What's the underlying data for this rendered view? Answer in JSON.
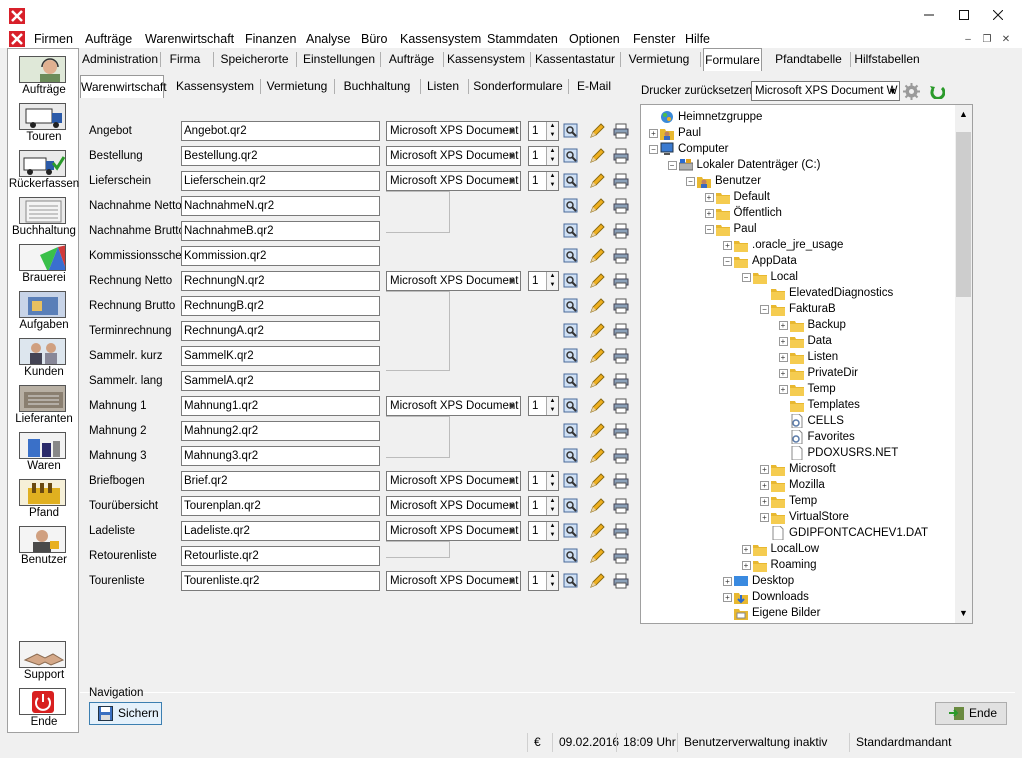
{
  "menu": {
    "items": [
      "Firmen",
      "Aufträge",
      "Warenwirtschaft",
      "Finanzen",
      "Analyse",
      "Büro",
      "Kassensystem",
      "Stammdaten",
      "Optionen",
      "Fenster",
      "Hilfe"
    ]
  },
  "sidebar": {
    "items": [
      {
        "label": "Aufträge",
        "icon": "headset-person-icon"
      },
      {
        "label": "Touren",
        "icon": "truck-icon"
      },
      {
        "label": "Rückerfassen",
        "icon": "truck-check-icon"
      },
      {
        "label": "Buchhaltung",
        "icon": "ledger-icon"
      },
      {
        "label": "Brauerei",
        "icon": "brewery-icon"
      },
      {
        "label": "Aufgaben",
        "icon": "tasks-icon"
      },
      {
        "label": "Kunden",
        "icon": "customers-icon"
      },
      {
        "label": "Lieferanten",
        "icon": "supplier-icon"
      },
      {
        "label": "Waren",
        "icon": "goods-icon"
      },
      {
        "label": "Pfand",
        "icon": "bottle-crate-icon"
      },
      {
        "label": "Benutzer",
        "icon": "user-icon"
      },
      {
        "label": "Support",
        "icon": "handshake-icon"
      },
      {
        "label": "Ende",
        "icon": "power-icon"
      }
    ]
  },
  "tabs_top": [
    "Administration",
    "Firma",
    "Speicherorte",
    "Einstellungen",
    "Aufträge",
    "Kassensystem",
    "Kassentastatur",
    "Vermietung",
    "Formulare",
    "Pfandtabelle",
    "Hilfstabellen"
  ],
  "tabs_sub": [
    "Warenwirtschaft",
    "Kassensystem",
    "Vermietung",
    "Buchhaltung",
    "Listen",
    "Sonderformulare",
    "E-Mail"
  ],
  "printer_reset": {
    "label": "Drucker zurücksetzen:",
    "value": "Microsoft XPS Document W"
  },
  "forms": [
    {
      "label": "Angebot",
      "file": "Angebot.qr2",
      "printer": "Microsoft XPS Document Writer",
      "copies": "1"
    },
    {
      "label": "Bestellung",
      "file": "Bestellung.qr2",
      "printer": "Microsoft XPS Document Writer",
      "copies": "1"
    },
    {
      "label": "Lieferschein",
      "file": "Lieferschein.qr2",
      "printer": "Microsoft XPS Document Writer",
      "copies": "1"
    },
    {
      "label": "Nachnahme Netto",
      "file": "NachnahmeN.qr2",
      "printer": "",
      "copies": ""
    },
    {
      "label": "Nachnahme Brutto",
      "file": "NachnahmeB.qr2",
      "printer": "",
      "copies": ""
    },
    {
      "label": "Kommissionsschein",
      "file": "Kommission.qr2",
      "printer": "",
      "copies": ""
    },
    {
      "label": "Rechnung Netto",
      "file": "RechnungN.qr2",
      "printer": "Microsoft XPS Document Writer",
      "copies": "1"
    },
    {
      "label": "Rechnung Brutto",
      "file": "RechnungB.qr2",
      "printer": "",
      "copies": ""
    },
    {
      "label": "Terminrechnung",
      "file": "RechnungA.qr2",
      "printer": "",
      "copies": ""
    },
    {
      "label": "Sammelr. kurz",
      "file": "SammelK.qr2",
      "printer": "",
      "copies": ""
    },
    {
      "label": "Sammelr. lang",
      "file": "SammelA.qr2",
      "printer": "",
      "copies": ""
    },
    {
      "label": "Mahnung 1",
      "file": "Mahnung1.qr2",
      "printer": "Microsoft XPS Document Writer",
      "copies": "1"
    },
    {
      "label": "Mahnung 2",
      "file": "Mahnung2.qr2",
      "printer": "",
      "copies": ""
    },
    {
      "label": "Mahnung 3",
      "file": "Mahnung3.qr2",
      "printer": "",
      "copies": ""
    },
    {
      "label": "Briefbogen",
      "file": "Brief.qr2",
      "printer": "Microsoft XPS Document Writer",
      "copies": "1"
    },
    {
      "label": "Tourübersicht",
      "file": "Tourenplan.qr2",
      "printer": "Microsoft XPS Document Writer",
      "copies": "1"
    },
    {
      "label": "Ladeliste",
      "file": "Ladeliste.qr2",
      "printer": "Microsoft XPS Document Writer",
      "copies": "1"
    },
    {
      "label": "Retourenliste",
      "file": "Retourliste.qr2",
      "printer": "",
      "copies": ""
    },
    {
      "label": "Tourenliste",
      "file": "Tourenliste.qr2",
      "printer": "Microsoft XPS Document Writer",
      "copies": "1"
    }
  ],
  "tree": [
    {
      "label": "Heimnetzgruppe",
      "depth": 0,
      "exp": "",
      "icon": "homegroup-icon"
    },
    {
      "label": "Paul",
      "depth": 0,
      "exp": "+",
      "icon": "user-folder-icon"
    },
    {
      "label": "Computer",
      "depth": 0,
      "exp": "-",
      "icon": "computer-icon"
    },
    {
      "label": "Lokaler Datenträger (C:)",
      "depth": 1,
      "exp": "-",
      "icon": "drive-icon"
    },
    {
      "label": "Benutzer",
      "depth": 2,
      "exp": "-",
      "icon": "user-folder-icon"
    },
    {
      "label": "Default",
      "depth": 3,
      "exp": "+",
      "icon": "folder-icon"
    },
    {
      "label": "Öffentlich",
      "depth": 3,
      "exp": "+",
      "icon": "folder-icon"
    },
    {
      "label": "Paul",
      "depth": 3,
      "exp": "-",
      "icon": "folder-icon"
    },
    {
      "label": ".oracle_jre_usage",
      "depth": 4,
      "exp": "+",
      "icon": "folder-icon"
    },
    {
      "label": "AppData",
      "depth": 4,
      "exp": "-",
      "icon": "folder-icon"
    },
    {
      "label": "Local",
      "depth": 5,
      "exp": "-",
      "icon": "folder-icon"
    },
    {
      "label": "ElevatedDiagnostics",
      "depth": 6,
      "exp": "",
      "icon": "folder-icon"
    },
    {
      "label": "FakturaB",
      "depth": 6,
      "exp": "-",
      "icon": "folder-icon"
    },
    {
      "label": "Backup",
      "depth": 7,
      "exp": "+",
      "icon": "folder-icon"
    },
    {
      "label": "Data",
      "depth": 7,
      "exp": "+",
      "icon": "folder-icon"
    },
    {
      "label": "Listen",
      "depth": 7,
      "exp": "+",
      "icon": "folder-icon"
    },
    {
      "label": "PrivateDir",
      "depth": 7,
      "exp": "+",
      "icon": "folder-icon"
    },
    {
      "label": "Temp",
      "depth": 7,
      "exp": "+",
      "icon": "folder-icon"
    },
    {
      "label": "Templates",
      "depth": 7,
      "exp": "",
      "icon": "folder-icon"
    },
    {
      "label": "CELLS",
      "depth": 7,
      "exp": "",
      "icon": "settings-file-icon"
    },
    {
      "label": "Favorites",
      "depth": 7,
      "exp": "",
      "icon": "settings-file-icon"
    },
    {
      "label": "PDOXUSRS.NET",
      "depth": 7,
      "exp": "",
      "icon": "file-icon"
    },
    {
      "label": "Microsoft",
      "depth": 6,
      "exp": "+",
      "icon": "folder-icon"
    },
    {
      "label": "Mozilla",
      "depth": 6,
      "exp": "+",
      "icon": "folder-icon"
    },
    {
      "label": "Temp",
      "depth": 6,
      "exp": "+",
      "icon": "folder-icon"
    },
    {
      "label": "VirtualStore",
      "depth": 6,
      "exp": "+",
      "icon": "folder-icon"
    },
    {
      "label": "GDIPFONTCACHEV1.DAT",
      "depth": 6,
      "exp": "",
      "icon": "file-icon"
    },
    {
      "label": "LocalLow",
      "depth": 5,
      "exp": "+",
      "icon": "folder-icon"
    },
    {
      "label": "Roaming",
      "depth": 5,
      "exp": "+",
      "icon": "folder-icon"
    },
    {
      "label": "Desktop",
      "depth": 4,
      "exp": "+",
      "icon": "desktop-icon"
    },
    {
      "label": "Downloads",
      "depth": 4,
      "exp": "+",
      "icon": "downloads-icon"
    },
    {
      "label": "Eigene Bilder",
      "depth": 4,
      "exp": "",
      "icon": "pictures-icon"
    }
  ],
  "navigation": {
    "label": "Navigation",
    "save_button": "Sichern"
  },
  "end_button": "Ende",
  "status": {
    "currency": "€",
    "date": "09.02.2016",
    "time": "18:09 Uhr",
    "user_admin": "Benutzerverwaltung inaktiv",
    "client": "Standardmandant"
  }
}
